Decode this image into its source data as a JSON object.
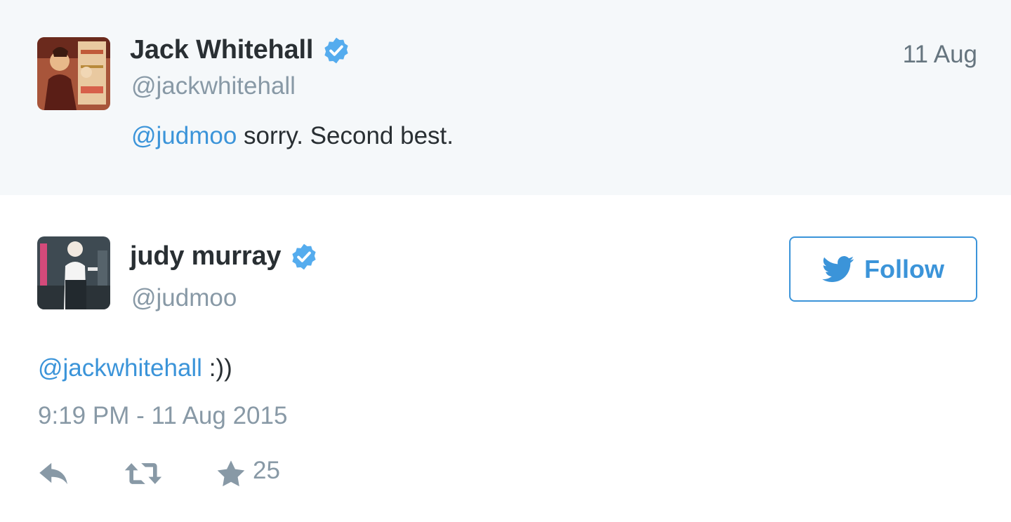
{
  "parent_tweet": {
    "author_name": "Jack Whitehall",
    "handle": "@jackwhitehall",
    "date": "11 Aug",
    "mention": "@judmoo",
    "text": " sorry. Second best."
  },
  "main_tweet": {
    "author_name": "judy murray",
    "handle": "@judmoo",
    "follow_label": "Follow",
    "mention": "@jackwhitehall",
    "text": " :))",
    "timestamp": "9:19 PM - 11 Aug 2015",
    "favorite_count": "25"
  },
  "icons": {
    "verified": "verified-badge-icon",
    "reply": "reply-icon",
    "retweet": "retweet-icon",
    "favorite": "star-icon",
    "follow": "twitter-bird-icon"
  },
  "colors": {
    "link": "#3b94d9",
    "verified": "#55acee",
    "muted": "#8899a6",
    "parent_bg": "#f5f8fa"
  }
}
